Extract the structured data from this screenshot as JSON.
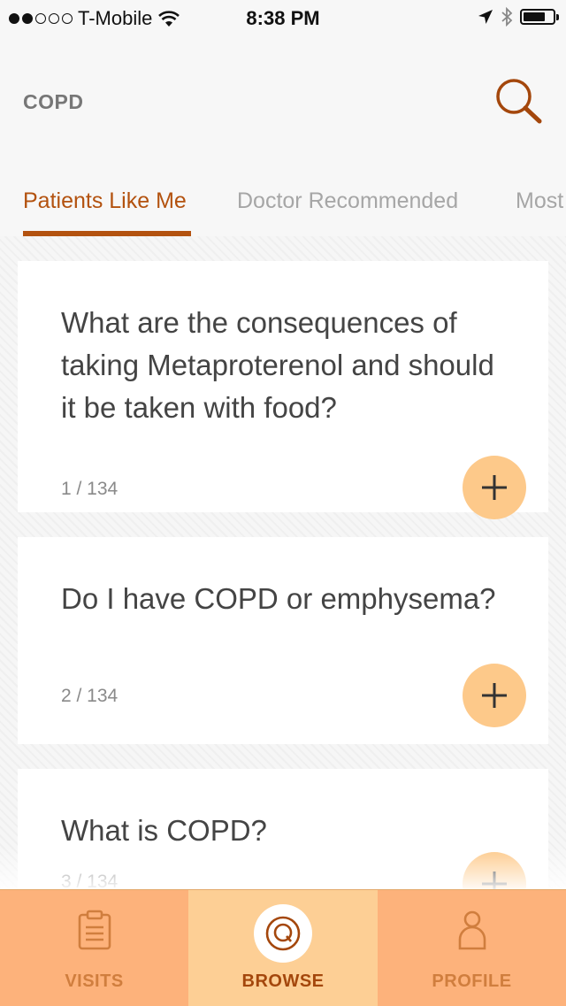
{
  "status_bar": {
    "carrier": "T-Mobile",
    "time": "8:38 PM",
    "signal_bars": 2
  },
  "header": {
    "title": "COPD"
  },
  "tabs": [
    {
      "label": "Patients Like Me",
      "active": true
    },
    {
      "label": "Doctor Recommended",
      "active": false
    },
    {
      "label": "Most",
      "active": false
    }
  ],
  "questions": [
    {
      "text": "What are the consequences of taking Metaproterenol and should it be taken with food?",
      "count": "1 / 134"
    },
    {
      "text": "Do I have COPD or emphysema?",
      "count": "2 / 134"
    },
    {
      "text": "What is COPD?",
      "count": "3 / 134"
    }
  ],
  "bottom_nav": [
    {
      "label": "VISITS",
      "icon": "clipboard-icon",
      "active": false
    },
    {
      "label": "BROWSE",
      "icon": "q-circle-icon",
      "active": true
    },
    {
      "label": "PROFILE",
      "icon": "person-icon",
      "active": false
    }
  ],
  "colors": {
    "accent": "#b3520f",
    "add_button": "#fdc98a",
    "nav_bg": "#fdb27b",
    "nav_active_bg": "#fdcf95"
  }
}
